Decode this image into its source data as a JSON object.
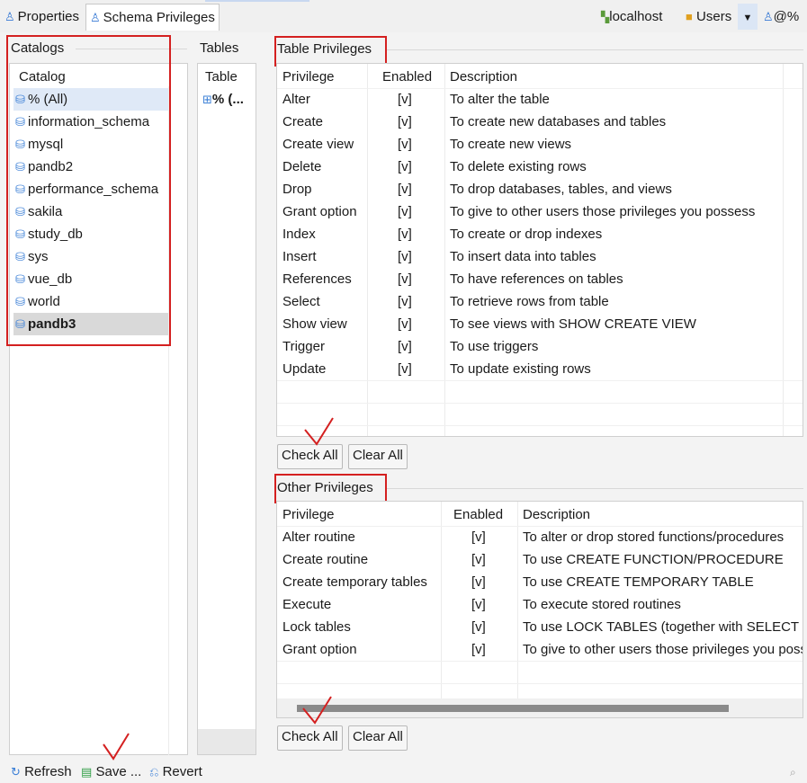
{
  "tabs": [
    {
      "label": "Properties",
      "icon": "user-icon"
    },
    {
      "label": "Schema Privileges",
      "icon": "user-icon"
    }
  ],
  "toolbar_right": {
    "connection": "localhost",
    "users": "Users",
    "user_at": "@%"
  },
  "catalogs": {
    "header": "Catalogs",
    "column": "Catalog",
    "items": [
      "% (All)",
      "information_schema",
      "mysql",
      "pandb2",
      "performance_schema",
      "sakila",
      "study_db",
      "sys",
      "vue_db",
      "world",
      "pandb3"
    ]
  },
  "tables": {
    "header": "Tables",
    "column": "Table",
    "items": [
      "% (..."
    ]
  },
  "table_privileges": {
    "header": "Table Privileges",
    "columns": [
      "Privilege",
      "Enabled",
      "Description"
    ],
    "rows": [
      [
        "Alter",
        "[v]",
        "To alter the table"
      ],
      [
        "Create",
        "[v]",
        "To create new databases and tables"
      ],
      [
        "Create view",
        "[v]",
        "To create new views"
      ],
      [
        "Delete",
        "[v]",
        "To delete existing rows"
      ],
      [
        "Drop",
        "[v]",
        "To drop databases, tables, and views"
      ],
      [
        "Grant option",
        "[v]",
        "To give to other users those privileges you possess"
      ],
      [
        "Index",
        "[v]",
        "To create or drop indexes"
      ],
      [
        "Insert",
        "[v]",
        "To insert data into tables"
      ],
      [
        "References",
        "[v]",
        "To have references on tables"
      ],
      [
        "Select",
        "[v]",
        "To retrieve rows from table"
      ],
      [
        "Show view",
        "[v]",
        "To see views with SHOW CREATE VIEW"
      ],
      [
        "Trigger",
        "[v]",
        "To use triggers"
      ],
      [
        "Update",
        "[v]",
        "To update existing rows"
      ]
    ],
    "check_all": "Check All",
    "clear_all": "Clear All"
  },
  "other_privileges": {
    "header": "Other Privileges",
    "columns": [
      "Privilege",
      "Enabled",
      "Description"
    ],
    "rows": [
      [
        "Alter routine",
        "[v]",
        "To alter or drop stored functions/procedures"
      ],
      [
        "Create routine",
        "[v]",
        "To use CREATE FUNCTION/PROCEDURE"
      ],
      [
        "Create temporary tables",
        "[v]",
        "To use CREATE TEMPORARY TABLE"
      ],
      [
        "Execute",
        "[v]",
        "To execute stored routines"
      ],
      [
        "Lock tables",
        "[v]",
        "To use LOCK TABLES (together with SELECT privilege)"
      ],
      [
        "Grant option",
        "[v]",
        "To give to other users those privileges you possess"
      ]
    ],
    "check_all": "Check All",
    "clear_all": "Clear All"
  },
  "bottom_toolbar": {
    "refresh": "Refresh",
    "save": "Save ...",
    "revert": "Revert"
  },
  "colors": {
    "annotation_red": "#d42020",
    "selection": "#dfe9f7",
    "db_icon": "#3b7fd6"
  }
}
